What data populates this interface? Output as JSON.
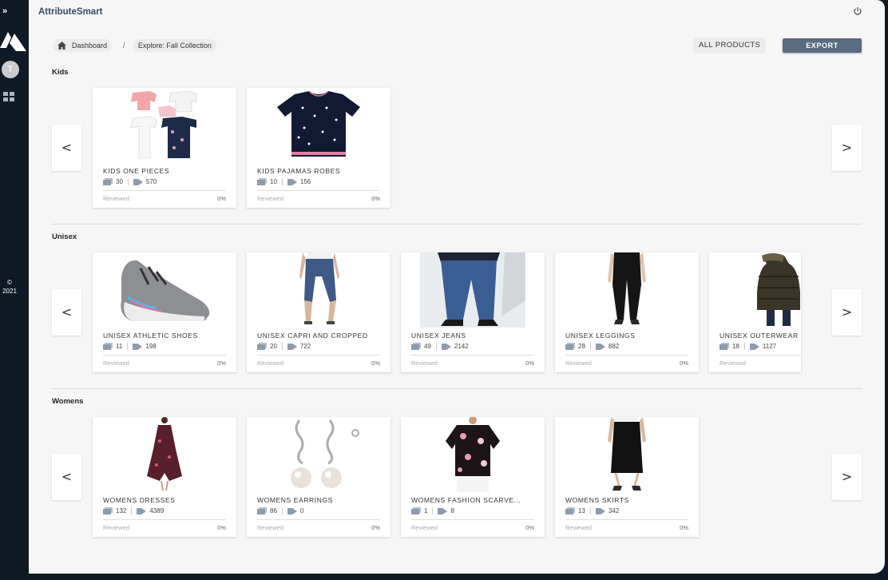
{
  "app": {
    "title": "AttributeSmart"
  },
  "sidebar": {
    "avatar_initial": "T",
    "copyright": "©\n2021",
    "expand_label": "»"
  },
  "breadcrumb": {
    "home": "Dashboard",
    "separator": "/",
    "current": "Explore: Fall Collection"
  },
  "actions": {
    "all_products": "ALL PRODUCTS",
    "export": "EXPORT"
  },
  "nav": {
    "prev": "<",
    "next": ">"
  },
  "sections": [
    {
      "title": "Kids",
      "cards": [
        {
          "name": "KIDS ONE PIECES",
          "images": "30",
          "tags": "570",
          "reviewed": "Reviewed",
          "pct": "0%"
        },
        {
          "name": "KIDS PAJAMAS ROBES",
          "images": "10",
          "tags": "156",
          "reviewed": "Reviewed",
          "pct": "0%"
        }
      ]
    },
    {
      "title": "Unisex",
      "cards": [
        {
          "name": "UNISEX ATHLETIC SHOES",
          "images": "11",
          "tags": "198",
          "reviewed": "Reviewed",
          "pct": "0%"
        },
        {
          "name": "UNISEX CAPRI AND CROPPED",
          "images": "20",
          "tags": "722",
          "reviewed": "Reviewed",
          "pct": "0%"
        },
        {
          "name": "UNISEX JEANS",
          "images": "49",
          "tags": "2142",
          "reviewed": "Reviewed",
          "pct": "0%"
        },
        {
          "name": "UNISEX LEGGINGS",
          "images": "28",
          "tags": "882",
          "reviewed": "Reviewed",
          "pct": "0%"
        },
        {
          "name": "UNISEX OUTERWEAR",
          "images": "18",
          "tags": "1127",
          "reviewed": "Reviewed",
          "pct": "0%"
        }
      ]
    },
    {
      "title": "Womens",
      "cards": [
        {
          "name": "WOMENS DRESSES",
          "images": "132",
          "tags": "4389",
          "reviewed": "Reviewed",
          "pct": "0%"
        },
        {
          "name": "WOMENS EARRINGS",
          "images": "86",
          "tags": "0",
          "reviewed": "Reviewed",
          "pct": "0%"
        },
        {
          "name": "WOMENS FASHION SCARVE...",
          "images": "1",
          "tags": "8",
          "reviewed": "Reviewed",
          "pct": "0%"
        },
        {
          "name": "WOMENS SKIRTS",
          "images": "13",
          "tags": "342",
          "reviewed": "Reviewed",
          "pct": "0%"
        }
      ]
    }
  ],
  "colors": {
    "sidebar": "#0f1a24",
    "accent": "#5b6b80",
    "title": "#3a4a66"
  }
}
